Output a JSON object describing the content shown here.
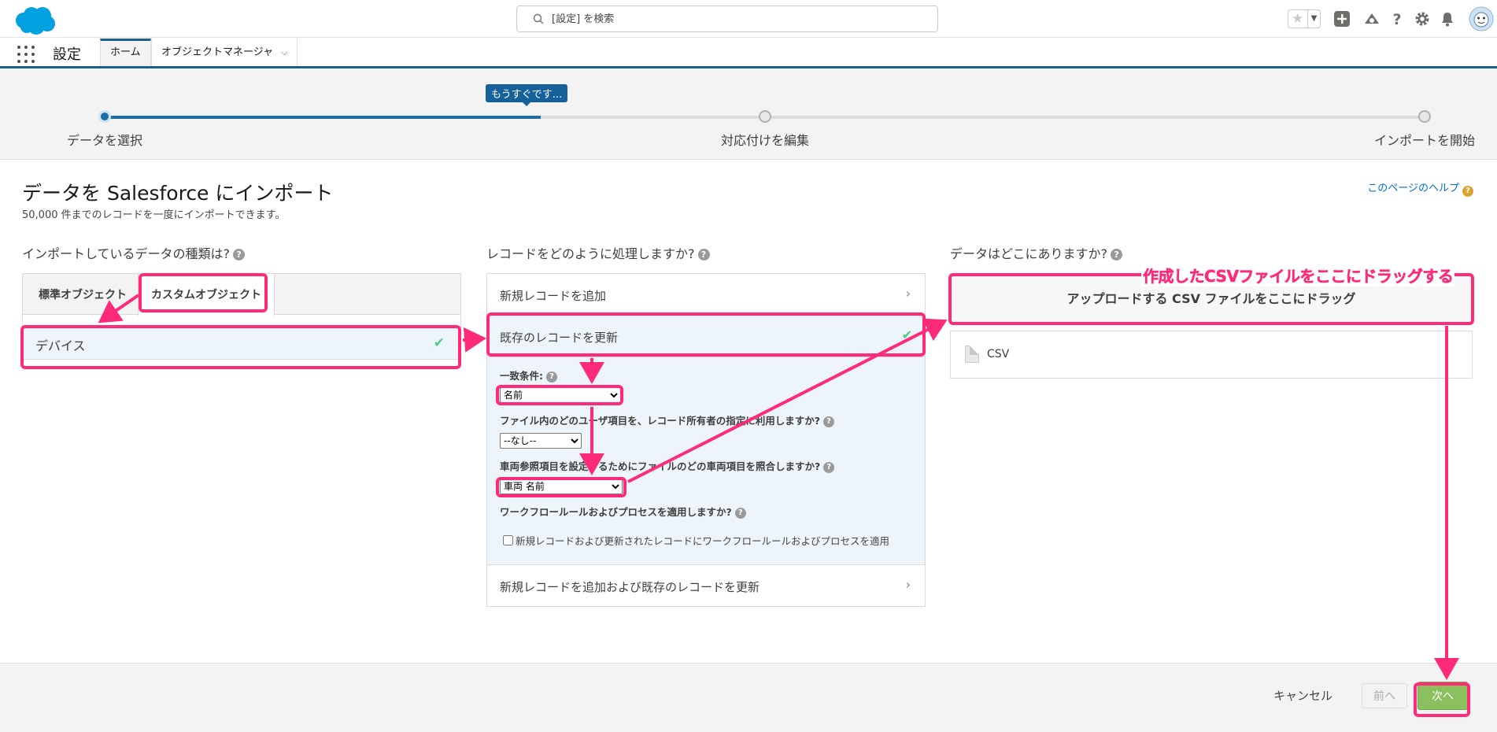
{
  "header": {
    "search_placeholder": "[設定] を検索",
    "icons": [
      "favorites-star-icon",
      "add-icon",
      "trailhead-icon",
      "help-icon",
      "gear-icon",
      "bell-icon",
      "avatar"
    ]
  },
  "app_nav": {
    "app_name": "設定",
    "tabs": [
      {
        "label": "ホーム"
      },
      {
        "label": "オブジェクトマネージャ"
      }
    ]
  },
  "progress": {
    "tooltip": "もうすぐです...",
    "completion": 0.33,
    "steps": [
      {
        "label": "データを選択"
      },
      {
        "label": "対応付けを編集"
      },
      {
        "label": "インポートを開始"
      }
    ]
  },
  "page": {
    "title": "データを Salesforce にインポート",
    "subtitle": "50,000 件までのレコードを一度にインポートできます。",
    "help_link": "このページのヘルプ"
  },
  "col1": {
    "heading": "インポートしているデータの種類は?",
    "tabs": [
      "標準オブジェクト",
      "カスタムオブジェクト"
    ],
    "selected_object": "デバイス"
  },
  "col2": {
    "heading": "レコードをどのように処理しますか?",
    "actions": [
      "新規レコードを追加",
      "既存のレコードを更新",
      "新規レコードを追加および既存のレコードを更新"
    ],
    "match_label": "一致条件:",
    "match_value": "名前",
    "owner_label": "ファイル内のどのユーザ項目を、レコード所有者の指定に利用しますか?",
    "owner_value": "--なし--",
    "lookup_label": "車両参照項目を設定するためにファイルのどの車両項目を照合しますか?",
    "lookup_value": "車両 名前",
    "workflow_label": "ワークフロールールおよびプロセスを適用しますか?",
    "workflow_checkbox": "新規レコードおよび更新されたレコードにワークフロールールおよびプロセスを適用"
  },
  "col3": {
    "heading": "データはどこにありますか?",
    "upload_label": "アップロードする CSV ファイルをここにドラッグ",
    "file_type": "CSV"
  },
  "footer": {
    "cancel": "キャンセル",
    "prev": "前へ",
    "next": "次へ"
  },
  "annotation": {
    "callout": "作成したCSVファイルをここにドラッグする",
    "color": "#ff2b78"
  },
  "colors": {
    "brand_blue": "#1b6fa8",
    "success_green": "#4bca81",
    "next_button": "#8cc05f"
  }
}
